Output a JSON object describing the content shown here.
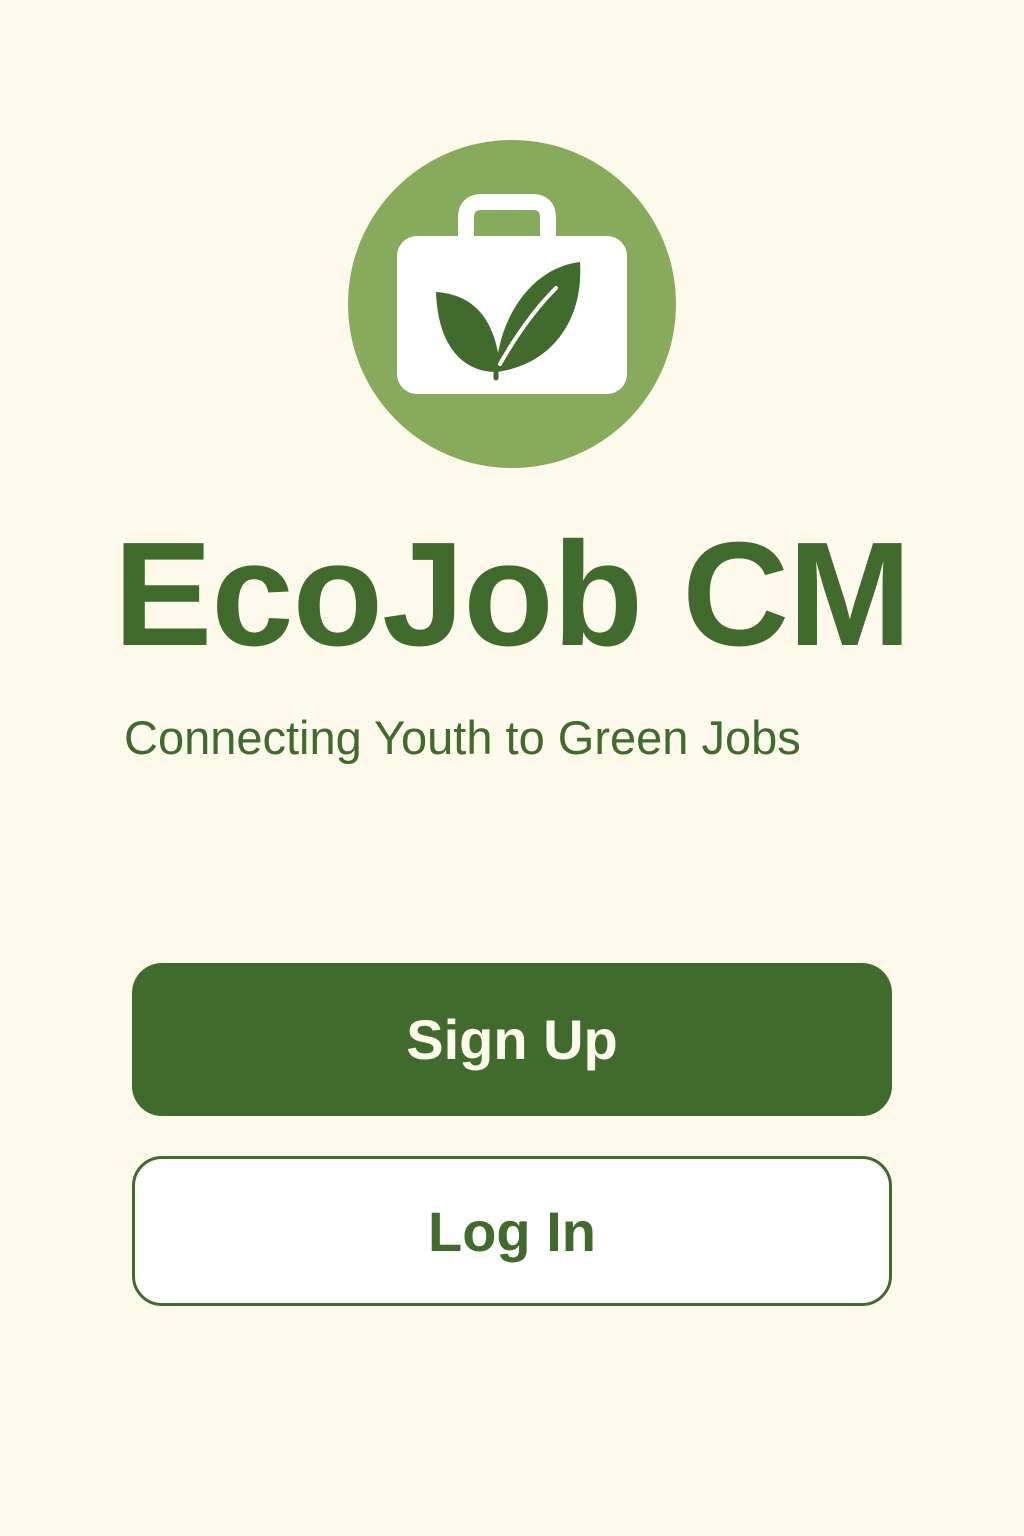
{
  "app": {
    "title": "EcoJob CM",
    "tagline": "Connecting Youth to Green Jobs"
  },
  "logo": {
    "icon": "briefcase-leaf-icon"
  },
  "actions": {
    "signup_label": "Sign Up",
    "login_label": "Log In"
  },
  "colors": {
    "background": "#fdfaec",
    "primary": "#416a2d",
    "logo_circle": "#86ab5c",
    "button_text_light": "#fdfaec",
    "secondary_button_bg": "#ffffff"
  }
}
